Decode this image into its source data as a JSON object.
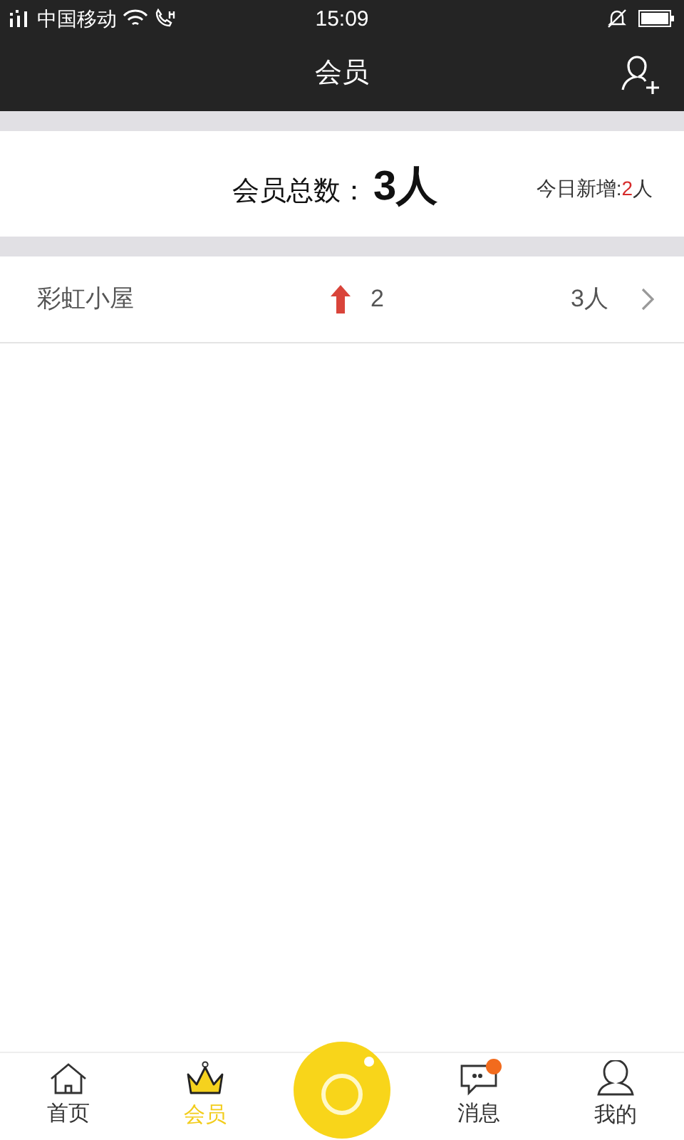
{
  "status_bar": {
    "carrier": "中国移动",
    "time": "15:09"
  },
  "header": {
    "title": "会员"
  },
  "summary": {
    "label": "会员总数：",
    "total": "3人",
    "today_label": "今日新增:",
    "today_count": "2",
    "today_unit": "人"
  },
  "stores": [
    {
      "name": "彩虹小屋",
      "increase": true,
      "change": "2",
      "members": "3人"
    }
  ],
  "nav": [
    {
      "kind": "home",
      "label": "首页",
      "selected": false,
      "badge": false
    },
    {
      "kind": "crown",
      "label": "会员",
      "selected": true,
      "badge": false
    },
    {
      "kind": "camera"
    },
    {
      "kind": "chat",
      "label": "消息",
      "selected": false,
      "badge": true
    },
    {
      "kind": "person",
      "label": "我的",
      "selected": false,
      "badge": false
    }
  ]
}
